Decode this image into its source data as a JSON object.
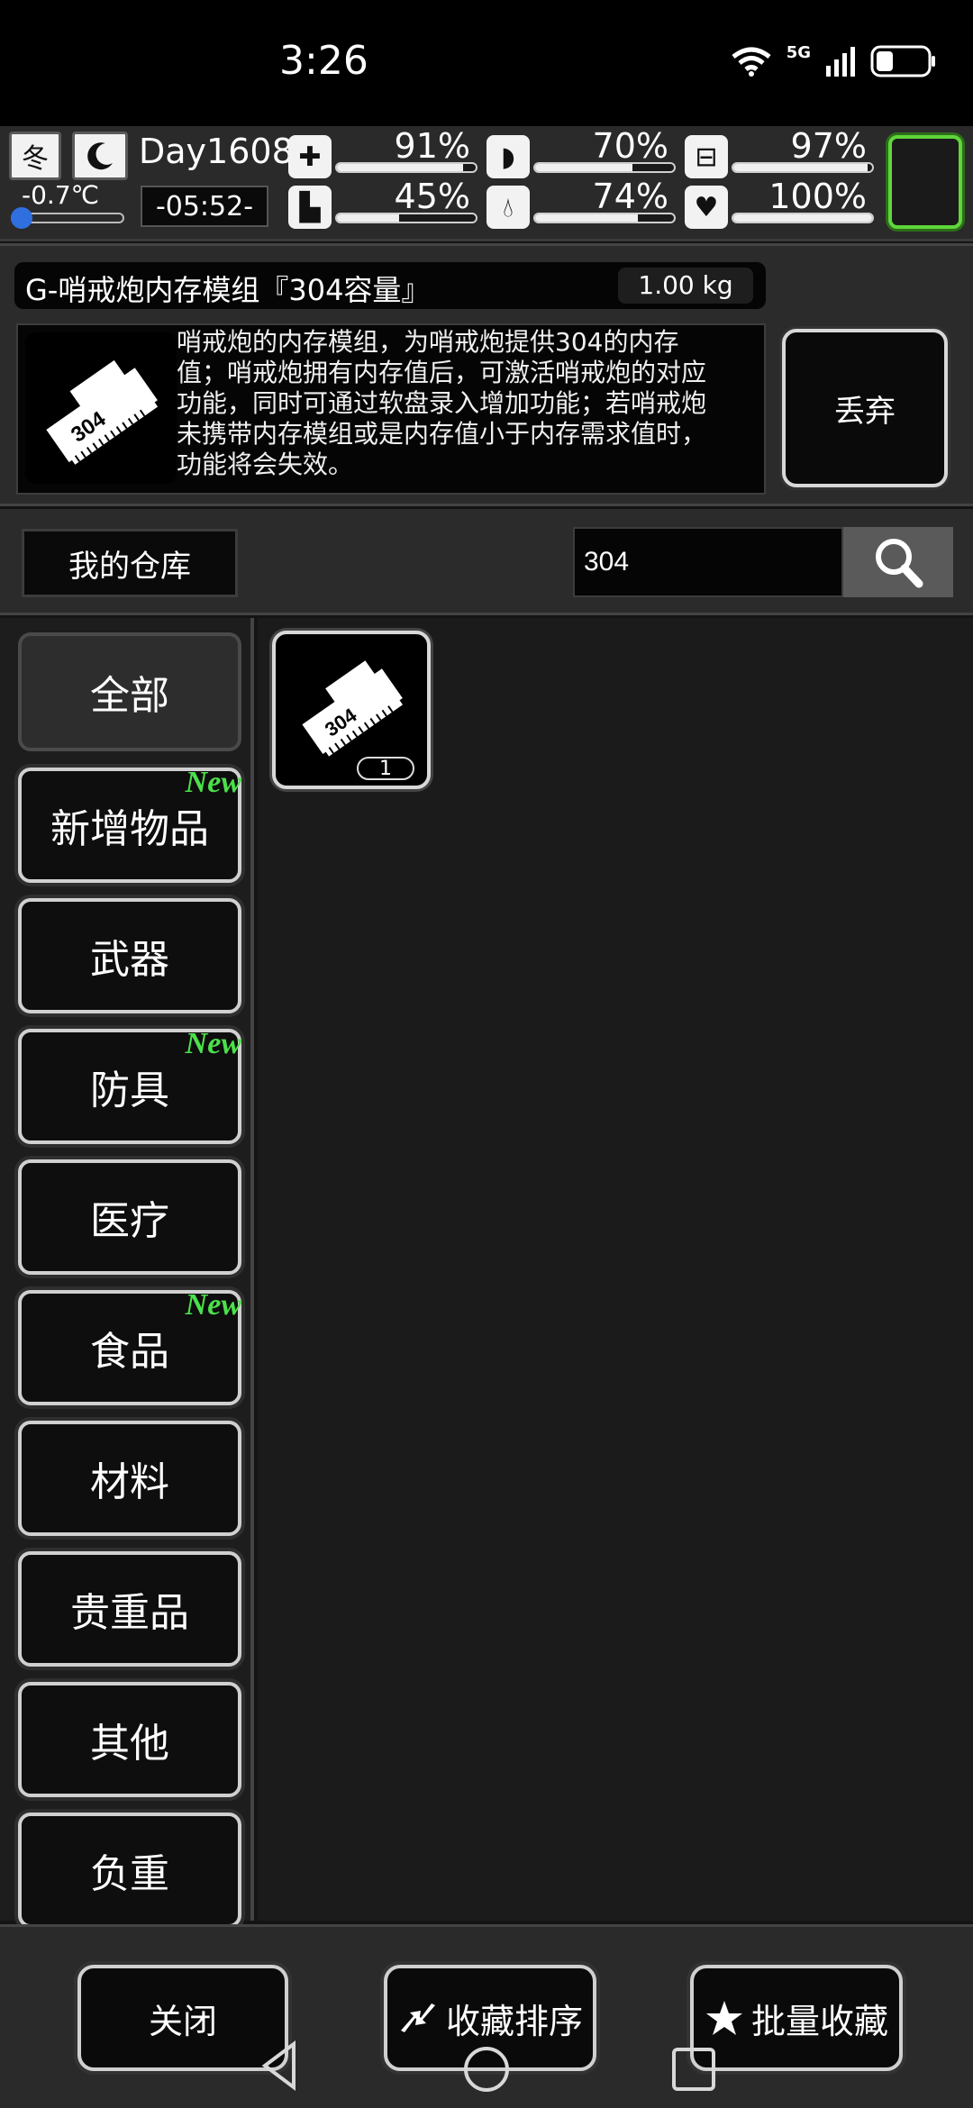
{
  "status_bar": {
    "time": "3:26",
    "network": "5G"
  },
  "hud": {
    "season": "冬",
    "temperature": "-0.7℃",
    "day": "Day1608",
    "clock": "-05:52-",
    "stats": [
      {
        "icon": "medkit-icon",
        "value": "91%",
        "level": 0.91
      },
      {
        "icon": "stomach-icon",
        "value": "70%",
        "level": 0.7
      },
      {
        "icon": "pill-icon",
        "value": "97%",
        "level": 0.97
      },
      {
        "icon": "boot-icon",
        "value": "45%",
        "level": 0.45
      },
      {
        "icon": "water-drop-icon",
        "value": "74%",
        "level": 0.74
      },
      {
        "icon": "heart-icon",
        "value": "100%",
        "level": 1.0
      }
    ]
  },
  "item": {
    "title": "G-哨戒炮内存模组『304容量』",
    "weight": "1.00 kg",
    "desc_lines": [
      "哨戒炮的内存模组，为哨戒炮提供304的内存",
      "值；哨戒炮拥有内存值后，可激活哨戒炮的对应",
      "功能，同时可通过软盘录入增加功能；若哨戒炮",
      "未携带内存模组或是内存值小于内存需求值时，",
      "功能将会失效。"
    ],
    "icon_label": "304",
    "discard": "丢弃"
  },
  "warehouse": {
    "label": "我的仓库",
    "search_value": "304"
  },
  "categories": [
    {
      "label": "全部",
      "new": ""
    },
    {
      "label": "新增物品",
      "new": "New"
    },
    {
      "label": "武器",
      "new": ""
    },
    {
      "label": "防具",
      "new": "New"
    },
    {
      "label": "医疗",
      "new": ""
    },
    {
      "label": "食品",
      "new": "New"
    },
    {
      "label": "材料",
      "new": ""
    },
    {
      "label": "贵重品",
      "new": ""
    },
    {
      "label": "其他",
      "new": ""
    },
    {
      "label": "负重",
      "new": ""
    }
  ],
  "grid": {
    "slot_count": "1",
    "slot_icon_label": "304"
  },
  "bottom": {
    "close": "关闭",
    "sort": "收藏排序",
    "batch": "批量收藏"
  }
}
